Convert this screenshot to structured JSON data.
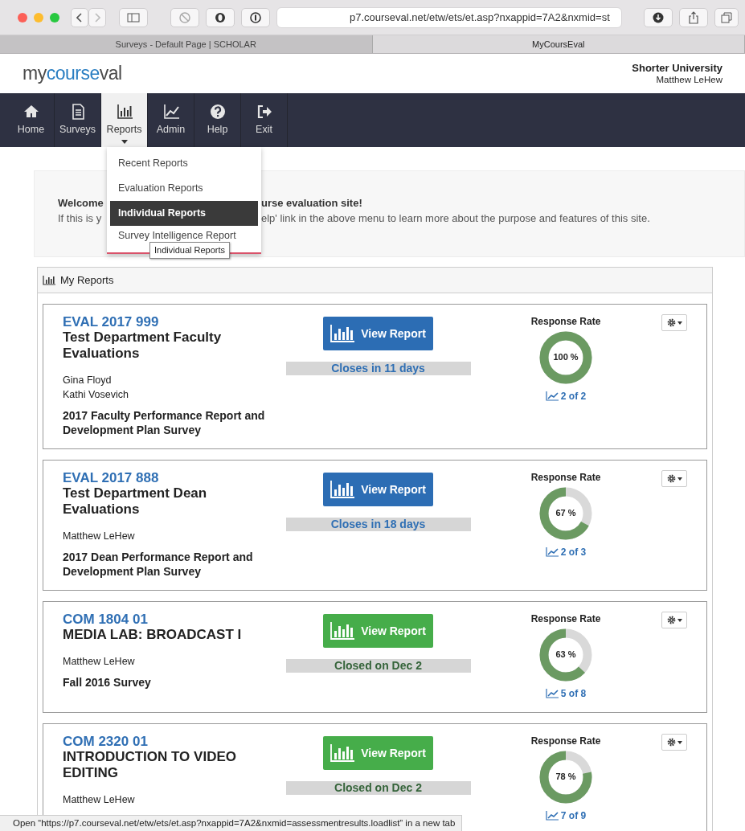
{
  "browser": {
    "url": "p7.courseval.net/etw/ets/et.asp?nxappid=7A2&nxmid=st",
    "tabs": [
      {
        "label": "Surveys - Default Page | SCHOLAR",
        "selected": false
      },
      {
        "label": "MyCoursEval",
        "selected": true
      }
    ]
  },
  "header": {
    "logo": [
      {
        "text": "my",
        "accent": false
      },
      {
        "text": "course",
        "accent": true
      },
      {
        "text": "val",
        "accent": false
      }
    ],
    "org": "Shorter University",
    "user": "Matthew LeHew"
  },
  "nav": [
    {
      "label": "Home",
      "kind": "home",
      "selected": false
    },
    {
      "label": "Surveys",
      "kind": "document",
      "selected": false
    },
    {
      "label": "Reports",
      "kind": "bars",
      "selected": true
    },
    {
      "label": "Admin",
      "kind": "trend",
      "selected": false
    },
    {
      "label": "Help",
      "kind": "help",
      "selected": false
    },
    {
      "label": "Exit",
      "kind": "exit",
      "selected": false
    }
  ],
  "dropdown": {
    "items": [
      {
        "label": "Recent Reports",
        "selected": false
      },
      {
        "label": "Evaluation Reports",
        "selected": false
      },
      {
        "label": "Individual Reports",
        "selected": true
      },
      {
        "label": "Survey Intelligence Report",
        "selected": false
      }
    ],
    "tooltip": "Individual Reports"
  },
  "welcome": {
    "lines": [
      {
        "before": "Welcome",
        "after": "urse evaluation site!",
        "bold": true
      },
      {
        "before": "If this is y",
        "after": "elp' link in the above menu to learn more about the purpose and features of this site.",
        "bold": false
      }
    ]
  },
  "reports_panel": {
    "title": "My Reports",
    "reports": [
      {
        "code": "EVAL 2017 999",
        "title": "Test Department Faculty Evaluations",
        "people": [
          "Gina Floyd",
          "Kathi Vosevich"
        ],
        "survey": "2017 Faculty Performance Report and Development Plan Survey",
        "kind": "open",
        "button": "View Report",
        "deadline": "Closes in 11 days",
        "rate_label": "Response Rate",
        "level": 1.0,
        "percent": "100 %",
        "count": "2 of 2"
      },
      {
        "code": "EVAL 2017 888",
        "title": "Test Department Dean Evaluations",
        "people": [
          "Matthew LeHew"
        ],
        "survey": "2017 Dean Performance Report and Development Plan Survey",
        "kind": "open",
        "button": "View Report",
        "deadline": "Closes in 18 days",
        "rate_label": "Response Rate",
        "level": 0.67,
        "percent": "67 %",
        "count": "2 of 3"
      },
      {
        "code": "COM 1804 01",
        "title": "MEDIA LAB: BROADCAST I",
        "people": [
          "Matthew LeHew"
        ],
        "survey": "Fall 2016 Survey",
        "kind": "closed",
        "button": "View Report",
        "deadline": "Closed on Dec 2",
        "rate_label": "Response Rate",
        "level": 0.63,
        "percent": "63 %",
        "count": "5 of 8"
      },
      {
        "code": "COM 2320 01",
        "title": "INTRODUCTION TO VIDEO EDITING",
        "people": [
          "Matthew LeHew"
        ],
        "kind": "closed",
        "button": "View Report",
        "deadline": "Closed on Dec 2",
        "rate_label": "Response Rate",
        "level": 0.78,
        "percent": "78 %",
        "count": "7 of 9"
      }
    ]
  },
  "status_bar": "Open “https://p7.courseval.net/etw/ets/et.asp?nxappid=7A2&nxmid=assessmentresults.loadlist” in a new tab"
}
